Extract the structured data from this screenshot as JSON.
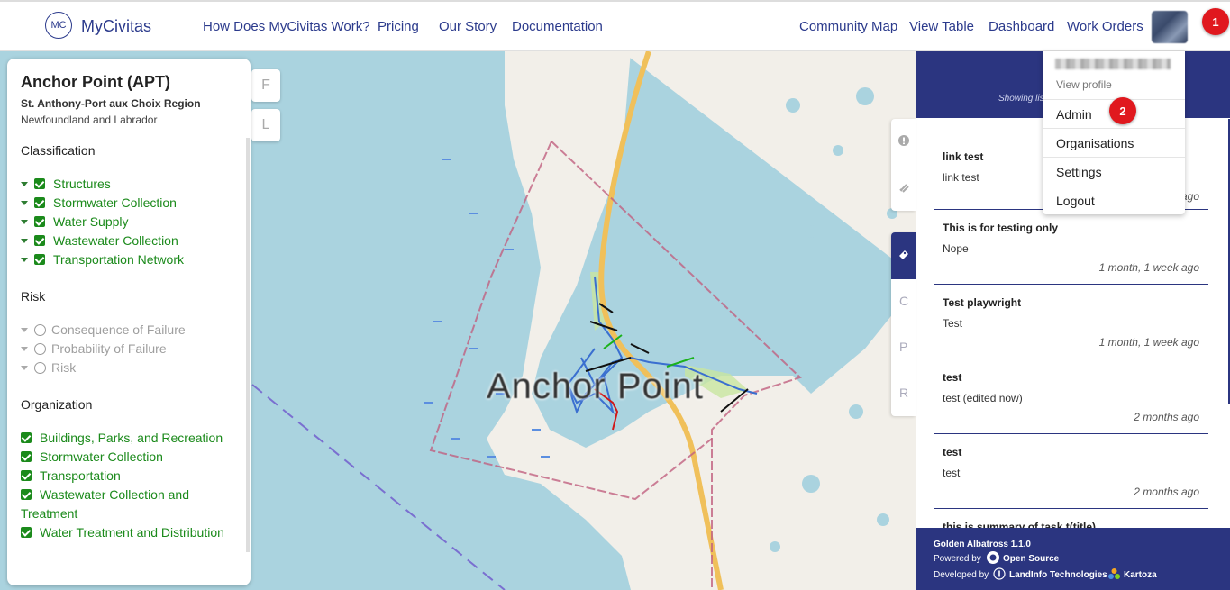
{
  "header": {
    "logo_text": "MC",
    "brand": "MyCivitas",
    "nav_left": [
      "How Does MyCivitas Work?",
      "Pricing",
      "Our Story",
      "Documentation"
    ],
    "nav_right": [
      "Community Map",
      "View Table",
      "Dashboard",
      "Work Orders"
    ],
    "badge_1": "1",
    "badge_2": "2"
  },
  "sidebar": {
    "title": "Anchor Point (APT)",
    "region": "St. Anthony-Port aux Choix Region",
    "province": "Newfoundland and Labrador",
    "classification_heading": "Classification",
    "classification_items": [
      "Structures",
      "Stormwater Collection",
      "Water Supply",
      "Wastewater Collection",
      "Transportation Network"
    ],
    "risk_heading": "Risk",
    "risk_items": [
      "Consequence of Failure",
      "Probability of Failure",
      "Risk"
    ],
    "organization_heading": "Organization",
    "organization_items": [
      "Buildings, Parks, and Recreation",
      "Stormwater Collection",
      "Transportation",
      "Wastewater Collection and",
      "Treatment",
      "Water Treatment and Distribution"
    ]
  },
  "map": {
    "place_label": "Anchor Point",
    "side_buttons": [
      "F",
      "L"
    ]
  },
  "vertical_tabs": [
    "C",
    "P",
    "R"
  ],
  "user_menu": {
    "view_profile": "View profile",
    "items": [
      "Admin",
      "Organisations",
      "Settings",
      "Logout"
    ]
  },
  "right_panel": {
    "showing_text": "Showing lis",
    "tasks": [
      {
        "title": "link test",
        "desc": "link test",
        "age": "ago"
      },
      {
        "title": "This is for testing only",
        "desc": "Nope",
        "age": "1 month, 1 week ago"
      },
      {
        "title": "Test playwright",
        "desc": "Test",
        "age": "1 month, 1 week ago"
      },
      {
        "title": "test",
        "desc": "test (edited now)",
        "age": "2 months ago"
      },
      {
        "title": "test",
        "desc": "test",
        "age": "2 months ago"
      },
      {
        "title": "this is summary of task t(title)",
        "desc": "",
        "age": ""
      }
    ],
    "footer": {
      "version": "Golden Albatross 1.1.0",
      "powered_by": "Powered by",
      "open_source": "Open Source",
      "developed_by": "Developed by",
      "dev1": "LandInfo Technologies",
      "dev2": "Kartoza"
    }
  },
  "colors": {
    "primary": "#2b3580",
    "layer_green": "#1b8a1b",
    "badge_red": "#e0181e"
  }
}
